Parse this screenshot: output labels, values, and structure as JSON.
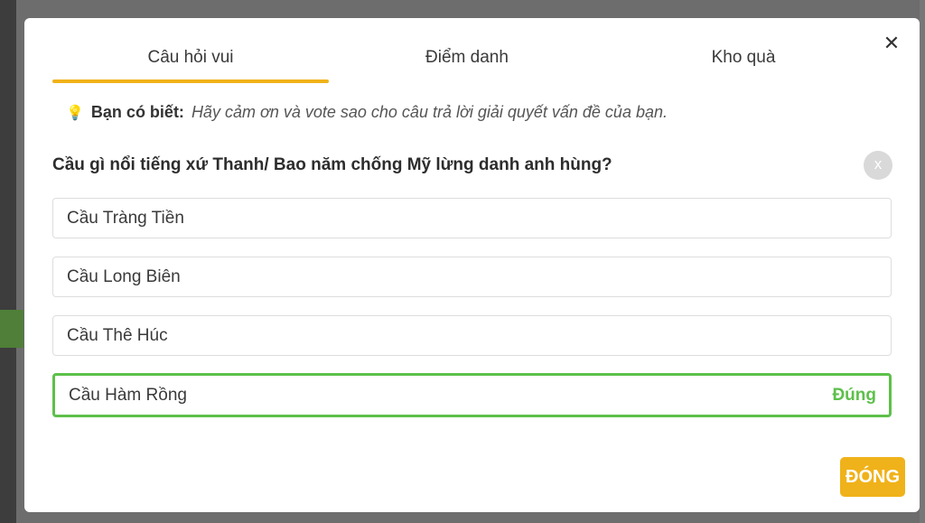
{
  "tabs": [
    {
      "label": "Câu hỏi vui",
      "active": true
    },
    {
      "label": "Điểm danh",
      "active": false
    },
    {
      "label": "Kho quà",
      "active": false
    }
  ],
  "close_symbol": "✕",
  "tip": {
    "icon": "bulb-icon",
    "label": "Bạn có biết:",
    "text": "Hãy cảm ơn và vote sao cho câu trả lời giải quyết vấn đề của bạn."
  },
  "question": {
    "text": "Cầu gì nổi tiếng xứ Thanh/ Bao năm chống Mỹ lừng danh anh hùng?",
    "dismiss_symbol": "x"
  },
  "answers": [
    {
      "text": "Cầu Tràng Tiền"
    },
    {
      "text": "Cầu Long Biên"
    },
    {
      "text": "Cầu Thê Húc"
    },
    {
      "text": "Cầu Hàm Rồng",
      "correct_label": "Đúng"
    }
  ],
  "done_label": "ĐÓNG",
  "colors": {
    "accent": "#f0b21a",
    "correct": "#5dc04b"
  }
}
